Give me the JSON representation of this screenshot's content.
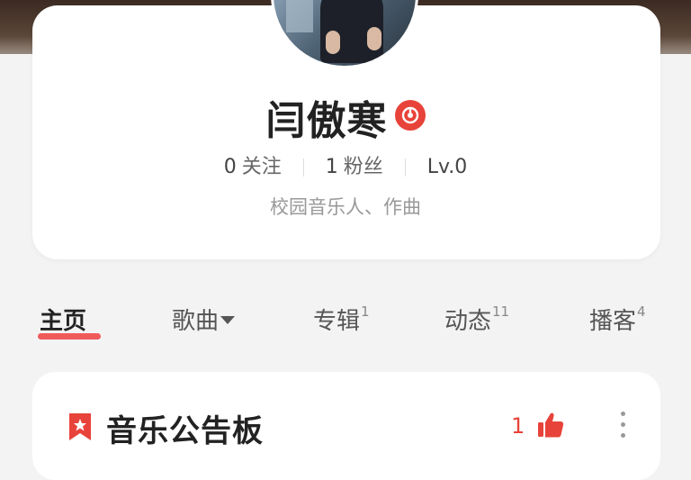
{
  "profile": {
    "username": "闫傲寒",
    "verified_icon": "music-verified-icon",
    "stats": [
      {
        "value": "0",
        "label": "关注"
      },
      {
        "value": "1",
        "label": "粉丝"
      },
      {
        "value": "Lv.0",
        "label": ""
      }
    ],
    "bio": "校园音乐人、作曲"
  },
  "tabs": [
    {
      "label": "主页",
      "count": ""
    },
    {
      "label": "歌曲",
      "count": ""
    },
    {
      "label": "专辑",
      "count": "1"
    },
    {
      "label": "动态",
      "count": "11"
    },
    {
      "label": "播客",
      "count": "4"
    }
  ],
  "board": {
    "title": "音乐公告板",
    "like_count": "1",
    "icons": [
      "bookmark-icon",
      "thumbs-up-icon",
      "more-vertical-icon"
    ]
  },
  "colors": {
    "accent": "#e8433a",
    "tab_underline": "#f05a5a"
  }
}
